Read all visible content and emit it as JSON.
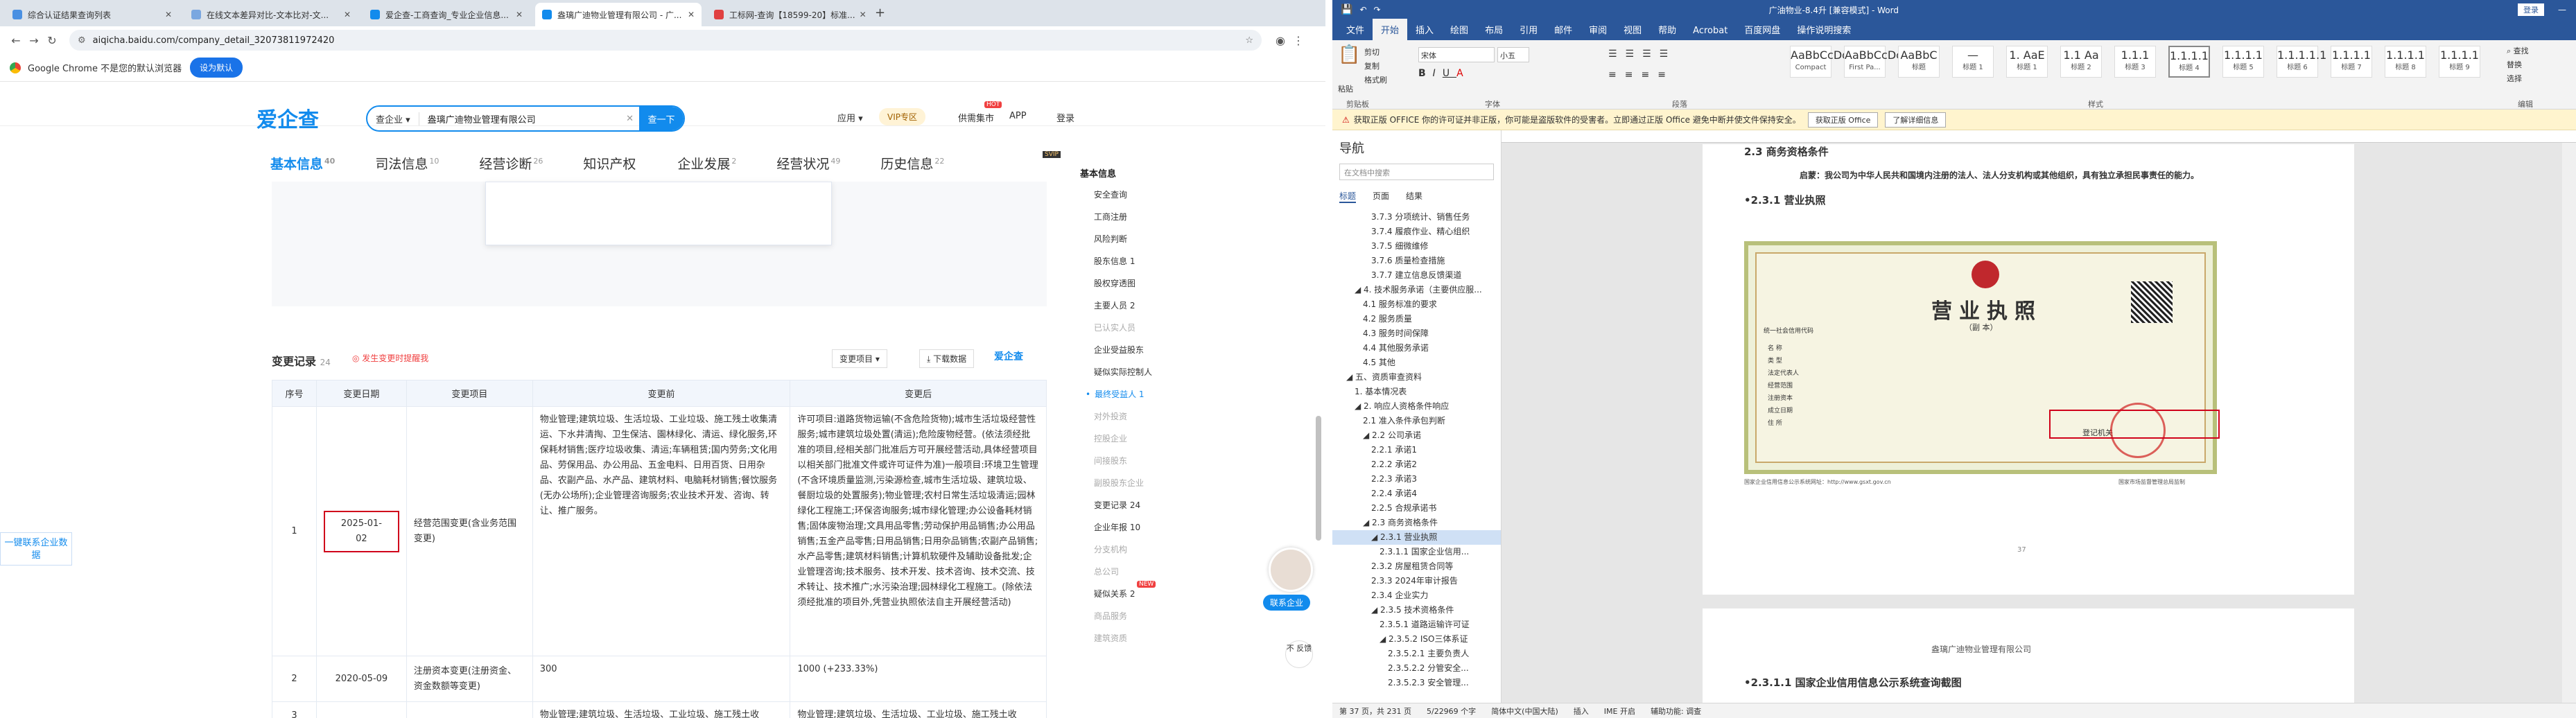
{
  "browser": {
    "tabs": [
      {
        "title": "综合认证结果查询列表"
      },
      {
        "title": "在线文本差异对比-文本比对-文..."
      },
      {
        "title": "爱企查-工商查询_专业企业信息..."
      },
      {
        "title": "盎璃广迪物业管理有限公司 - 广..."
      },
      {
        "title": "工标网-查询【18599-20】标准..."
      }
    ],
    "new_tab": "+",
    "url": "aiqicha.baidu.com/company_detail_32073811972420",
    "infobar_text": "Google Chrome 不是您的默认浏览器",
    "infobar_button": "设为默认"
  },
  "site": {
    "logo": "爱企查",
    "search_select": "查企业 ▾",
    "search_query": "盎璃广迪物业管理有限公司",
    "search_button": "查一下",
    "nav": [
      "应用 ▾",
      "VIP专区",
      "供需集市",
      "APP",
      "登录"
    ],
    "hot_badge": "HOT",
    "svip_badge": "SVIP"
  },
  "company_tabs": [
    {
      "label": "基本信息",
      "count": "40"
    },
    {
      "label": "司法信息",
      "count": "10"
    },
    {
      "label": "经营诊断",
      "count": "26"
    },
    {
      "label": "知识产权",
      "count": ""
    },
    {
      "label": "企业发展",
      "count": "2"
    },
    {
      "label": "经营状况",
      "count": "49"
    },
    {
      "label": "历史信息",
      "count": "22"
    }
  ],
  "changes": {
    "title": "变更记录",
    "count": "24",
    "warning": "◎ 发生变更时提醒我",
    "filter": "变更项目 ▾",
    "download": "下载数据",
    "watermark": "爱企查",
    "headers": [
      "序号",
      "变更日期",
      "变更项目",
      "变更前",
      "变更后"
    ],
    "rows": [
      {
        "no": "1",
        "date": "2025-01-02",
        "item": "经营范围变更(含业务范围变更)",
        "before": "物业管理;建筑垃圾、生活垃圾、工业垃圾、施工残土收集清运、下水井清掏、卫生保洁、園林绿化、清运、绿化服务,环保耗材销售;医疗垃圾收集、清运;车辆租赁;国内劳务;文化用品、劳保用品、办公用品、五金电料、日用百货、日用杂品、农副产品、水产品、建筑材料、电脑耗材销售;餐饮服务(无办公场所);企业管理咨询服务;农业技术开发、咨询、转让、推广服务。",
        "after": "许可项目:道路货物运输(不含危险货物);城市生活垃圾经营性服务;城市建筑垃圾处置(清运);危险废物经营。(依法须经批准的项目,经相关部门批准后方可开展经营活动,具体经营项目以相关部门批准文件或许可证件为准)一般项目:环境卫生管理(不含环境质量监测,污染源检查,城市生活垃圾、建筑垃圾、餐厨垃圾的处置服务);物业管理;农村日常生活垃圾清运;园林绿化工程施工;环保咨询服务;城市绿化管理;办公设备耗材销售;固体废物治理;文具用品零售;劳动保护用品销售;办公用品销售;五金产品零售;日用品销售;日用杂品销售;农副产品销售;水产品零售;建筑材料销售;计算机软硬件及辅助设备批发;企业管理咨询;技术服务、技术开发、技术咨询、技术交流、技术转让、技术推广;水污染治理;园林绿化工程施工。(除依法须经批准的项目外,凭营业执照依法自主开展经营活动)"
      },
      {
        "no": "2",
        "date": "2020-05-09",
        "item": "注册资本变更(注册资金、资金数额等变更)",
        "before": "300",
        "after": "1000 (+233.33%)"
      },
      {
        "no": "3",
        "date": "",
        "item": "",
        "before": "物业管理;建筑垃圾、生活垃圾、工业垃圾、施工残土收",
        "after": "物业管理;建筑垃圾、生活垃圾、工业垃圾、施工残土收"
      }
    ]
  },
  "side_nav": [
    {
      "label": "基本信息",
      "style": "h"
    },
    {
      "label": "安全查询",
      "style": "n"
    },
    {
      "label": "工商注册",
      "style": "n"
    },
    {
      "label": "风险判断",
      "style": "n"
    },
    {
      "label": "股东信息 1",
      "style": "n"
    },
    {
      "label": "股权穿透图",
      "style": "n"
    },
    {
      "label": "主要人员 2",
      "style": "n"
    },
    {
      "label": "已认实人员",
      "style": "g"
    },
    {
      "label": "企业受益股东",
      "style": "n"
    },
    {
      "label": "疑似实际控制人",
      "style": "n"
    },
    {
      "label": "最终受益人 1",
      "style": "act"
    },
    {
      "label": "对外投资",
      "style": "g"
    },
    {
      "label": "控股企业",
      "style": "g"
    },
    {
      "label": "间接股东",
      "style": "g"
    },
    {
      "label": "副股股东企业",
      "style": "g"
    },
    {
      "label": "变更记录 24",
      "style": "n"
    },
    {
      "label": "企业年报 10",
      "style": "n"
    },
    {
      "label": "分支机构",
      "style": "g"
    },
    {
      "label": "总公司",
      "style": "g"
    },
    {
      "label": "疑似关系 2",
      "style": "n"
    },
    {
      "label": "商品服务",
      "style": "g"
    },
    {
      "label": "建筑资质",
      "style": "g"
    }
  ],
  "side_new_badge": "NEW",
  "float_button": "一键联系企业数据",
  "avatar_label": "联系企业",
  "feedback": "不 反馈",
  "word": {
    "title": "广油物业-8.4升 [兼容模式] - Word",
    "login": "登录",
    "menu": [
      "文件",
      "开始",
      "插入",
      "绘图",
      "布局",
      "引用",
      "邮件",
      "审阅",
      "视图",
      "帮助",
      "Acrobat",
      "百度网盘",
      "操作说明搜索"
    ],
    "clipboard": [
      "剪切",
      "复制",
      "格式刷"
    ],
    "paste": "粘贴",
    "font_name": "宋体",
    "font_size": "小五",
    "styles": [
      {
        "preview": "AaBbCcDd",
        "name": "Compact"
      },
      {
        "preview": "AaBbCcDc",
        "name": "First Pa..."
      },
      {
        "preview": "AaBbC",
        "name": "标题"
      },
      {
        "preview": "—",
        "name": "标题 1"
      },
      {
        "preview": "1. AaE",
        "name": "标题 1"
      },
      {
        "preview": "1.1 Aa",
        "name": "标题 2"
      },
      {
        "preview": "1.1.1",
        "name": "标题 3"
      },
      {
        "preview": "1.1.1.1",
        "name": "标题 4"
      },
      {
        "preview": "1.1.1.1",
        "name": "标题 5"
      },
      {
        "preview": "1.1.1.1.1",
        "name": "标题 6"
      },
      {
        "preview": "1.1.1.1",
        "name": "标题 7"
      },
      {
        "preview": "1.1.1.1",
        "name": "标题 8"
      },
      {
        "preview": "1.1.1.1",
        "name": "标题 9"
      }
    ],
    "groups": [
      "剪贴板",
      "字体",
      "段落",
      "样式",
      "编辑"
    ],
    "edit": [
      "查找",
      "替换",
      "选择"
    ],
    "message": "获取正版 OFFICE  你的许可证并非正版，你可能是盗版软件的受害者。立即通过正版 Office 避免中断并使文件保持安全。",
    "msg_buttons": [
      "获取正版 Office",
      "了解详细信息"
    ],
    "nav_pane": {
      "title": "导航",
      "search_placeholder": "在文档中搜索",
      "tabs": [
        "标题",
        "页面",
        "结果"
      ],
      "items": [
        {
          "t": "3.7.3 分项统计、销售任务",
          "lvl": 4
        },
        {
          "t": "3.7.4 履痕作业、精心组织",
          "lvl": 4
        },
        {
          "t": "3.7.5 细微维修",
          "lvl": 4
        },
        {
          "t": "3.7.6 质量检查措施",
          "lvl": 4
        },
        {
          "t": "3.7.7 建立信息反馈渠道",
          "lvl": 4
        },
        {
          "t": "◢ 4. 技术服务承诺（主要供应服...",
          "lvl": 2
        },
        {
          "t": "4.1 服务标准的要求",
          "lvl": 3
        },
        {
          "t": "4.2 服务质量",
          "lvl": 3
        },
        {
          "t": "4.3 服务时间保障",
          "lvl": 3
        },
        {
          "t": "4.4 其他服务承诺",
          "lvl": 3
        },
        {
          "t": "4.5 其他",
          "lvl": 3
        },
        {
          "t": "◢ 五、资质审查资料",
          "lvl": 1
        },
        {
          "t": "1. 基本情况表",
          "lvl": 2
        },
        {
          "t": "◢ 2. 响应人资格条件响应",
          "lvl": 2
        },
        {
          "t": "2.1 准入条件承包判断",
          "lvl": 3
        },
        {
          "t": "◢ 2.2 公司承诺",
          "lvl": 3
        },
        {
          "t": "2.2.1 承诺1",
          "lvl": 4
        },
        {
          "t": "2.2.2 承诺2",
          "lvl": 4
        },
        {
          "t": "2.2.3 承诺3",
          "lvl": 4
        },
        {
          "t": "2.2.4 承诺4",
          "lvl": 4
        },
        {
          "t": "2.2.5 合规承诺书",
          "lvl": 4
        },
        {
          "t": "◢ 2.3 商务资格条件",
          "lvl": 3
        },
        {
          "t": "◢ 2.3.1 营业执照",
          "lvl": 4,
          "sel": true
        },
        {
          "t": "2.3.1.1 国家企业信用...",
          "lvl": 5
        },
        {
          "t": "2.3.2 房屋租赁合同等",
          "lvl": 4
        },
        {
          "t": "2.3.3 2024年审计报告",
          "lvl": 4
        },
        {
          "t": "2.3.4 企业实力",
          "lvl": 4
        },
        {
          "t": "◢ 2.3.5 技术资格条件",
          "lvl": 4
        },
        {
          "t": "2.3.5.1 道路运输许可证",
          "lvl": 5
        },
        {
          "t": "◢ 2.3.5.2 ISO三体系证",
          "lvl": 5
        },
        {
          "t": "2.3.5.2.1 主要负责人",
          "lvl": 6
        },
        {
          "t": "2.3.5.2.2 分管安全...",
          "lvl": 6
        },
        {
          "t": "2.3.5.2.3 安全管理...",
          "lvl": 6
        }
      ]
    },
    "doc": {
      "heading_partial": "2.3  商务资格条件",
      "promise": "启蒙：我公司为中华人民共和国境内注册的法人、法人分支机构或其他组织，具有独立承担民事责任的能力。",
      "section": "•2.3.1  营业执照",
      "license_title": "营业执照",
      "license_sub": "（副  本）",
      "license_code": "统一社会信用代码",
      "license_fields": [
        "名  称",
        "类  型",
        "法定代表人",
        "经营范围",
        "注册资本",
        "成立日期",
        "住  所"
      ],
      "registrar": "登记机关",
      "footer_left": "国家企业信用信息公示系统网址：http://www.gsxt.gov.cn",
      "footer_right": "国家市场监督管理总局监制",
      "page_no": "37",
      "page2_header": "盎璃广迪物业管理有限公司",
      "section2": "•2.3.1.1  国家企业信用信息公示系统查询截图"
    },
    "status": {
      "page": "第 37 页，共 231 页",
      "words": "5/22969 个字",
      "lang": "简体中文(中国大陆)",
      "insert": "插入",
      "ime": "IME 开启",
      "access": "辅助功能: 调查"
    }
  }
}
